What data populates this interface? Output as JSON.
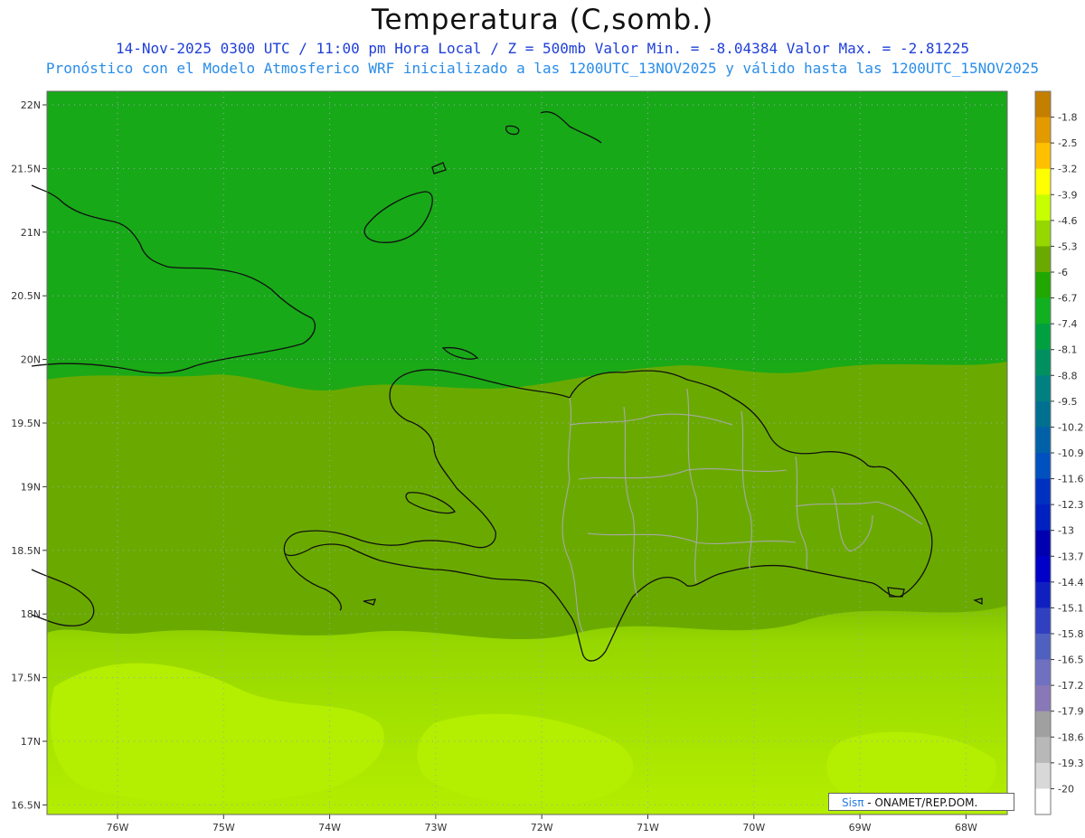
{
  "header": {
    "title": "Temperatura (C,somb.)",
    "line1": "14-Nov-2025 0300 UTC / 11:00 pm Hora Local / Z = 500mb Valor Min. = -8.04384 Valor Max. = -2.81225",
    "line2": "Pronóstico con el Modelo Atmosferico WRF inicializado a las 1200UTC_13NOV2025 y válido hasta las 1200UTC_15NOV2025"
  },
  "axes": {
    "lat_labels": [
      "22N",
      "21.5N",
      "21N",
      "20.5N",
      "20N",
      "19.5N",
      "19N",
      "18.5N",
      "18N",
      "17.5N",
      "17N",
      "16.5N"
    ],
    "lon_labels": [
      "76W",
      "75W",
      "74W",
      "73W",
      "72W",
      "71W",
      "70W",
      "69W",
      "68W"
    ]
  },
  "colorbar": {
    "labels": [
      "-1.8",
      "-2.5",
      "-3.2",
      "-3.9",
      "-4.6",
      "-5.3",
      "-6",
      "-6.7",
      "-7.4",
      "-8.1",
      "-8.8",
      "-9.5",
      "-10.2",
      "-10.9",
      "-11.6",
      "-12.3",
      "-13",
      "-13.7",
      "-14.4",
      "-15.1",
      "-15.8",
      "-16.5",
      "-17.2",
      "-17.9",
      "-18.6",
      "-19.3",
      "-20"
    ],
    "colors": [
      "#c47f00",
      "#e39a00",
      "#ffc000",
      "#ffff00",
      "#c8ff00",
      "#96d700",
      "#6aaa00",
      "#20a800",
      "#10b020",
      "#00a040",
      "#009060",
      "#008080",
      "#007090",
      "#0060a8",
      "#0050c0",
      "#0030c0",
      "#0020c0",
      "#0000b0",
      "#0000c8",
      "#1020c0",
      "#3040c0",
      "#5060c0",
      "#7070c0",
      "#8878b8",
      "#a0a0a0",
      "#b8b8b8",
      "#d8d8d8",
      "#ffffff"
    ]
  },
  "field_colors": {
    "north": "#18a818",
    "north_dark": "#0f9a1a",
    "mid": "#6aaa00",
    "south": "#96d700",
    "south_bright": "#b4ee00"
  },
  "credit": {
    "sis": "Sis",
    "pi": "π",
    "rest": "- ONAMET/REP.DOM."
  }
}
